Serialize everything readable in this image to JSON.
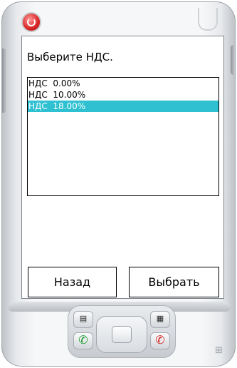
{
  "app": {
    "prompt": "Выберите НДС."
  },
  "list": {
    "items": [
      {
        "label": "НДС  0.00%",
        "selected": false
      },
      {
        "label": "НДС  10.00%",
        "selected": false
      },
      {
        "label": "НДС  18.00%",
        "selected": true
      }
    ]
  },
  "buttons": {
    "back_label": "Назад",
    "select_label": "Выбрать"
  },
  "colors": {
    "selection": "#2fc1d1",
    "power": "#d92424"
  },
  "icons": {
    "power": "power-icon",
    "contacts": "contacts-icon",
    "grid": "grid-icon",
    "call": "call-icon",
    "end": "end-call-icon",
    "windows": "windows-logo-icon"
  }
}
